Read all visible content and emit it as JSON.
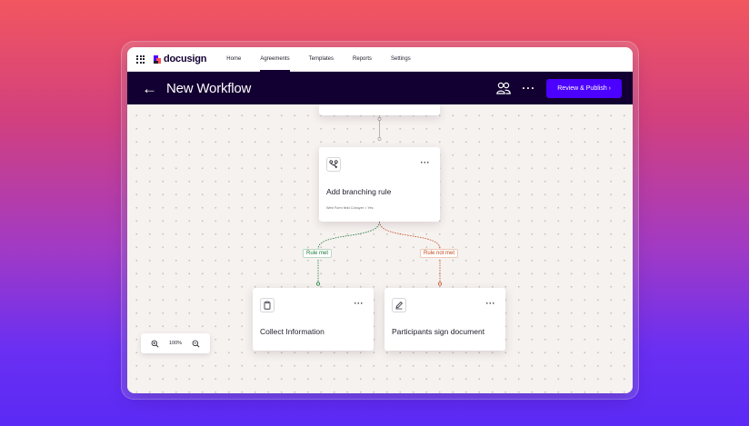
{
  "app": {
    "logo_text": "docusign"
  },
  "nav": {
    "items": [
      {
        "label": "Home",
        "active": false
      },
      {
        "label": "Agreements",
        "active": true
      },
      {
        "label": "Templates",
        "active": false
      },
      {
        "label": "Reports",
        "active": false
      },
      {
        "label": "Settings",
        "active": false
      }
    ]
  },
  "titlebar": {
    "back_glyph": "←",
    "title": "New Workflow",
    "more_glyph": "···",
    "publish_label": "Review & Publish  ›"
  },
  "workflow": {
    "branch_card": {
      "title": "Add branching rule",
      "condition": "Web Form field  Cobuyer = Yes",
      "more_glyph": "···",
      "icon": "branch-icon"
    },
    "rule_met_label": "Rule met",
    "rule_not_met_label": "Rule not met",
    "collect_card": {
      "title": "Collect Information",
      "more_glyph": "···",
      "icon": "clipboard-icon"
    },
    "sign_card": {
      "title": "Participants sign document",
      "more_glyph": "···",
      "icon": "pen-icon"
    }
  },
  "zoom": {
    "level": "100%"
  },
  "colors": {
    "brand_dark": "#130032",
    "brand_purple": "#4c00ff",
    "rule_met": "#1d7a3c",
    "rule_not_met": "#c2491c"
  }
}
